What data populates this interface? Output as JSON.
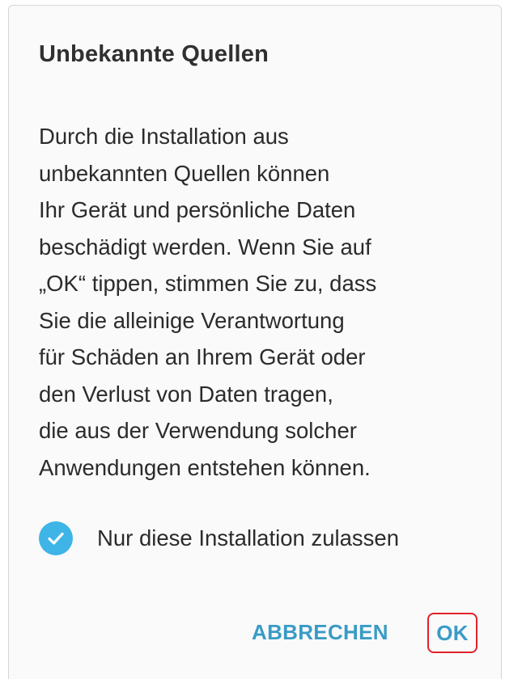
{
  "dialog": {
    "title": "Unbekannte Quellen",
    "message_lines": [
      "Durch die Installation aus",
      "unbekannten Quellen können",
      "Ihr Gerät und persönliche Daten",
      "beschädigt werden. Wenn Sie auf",
      "„OK“ tippen, stimmen Sie zu, dass",
      "Sie die alleinige Verantwortung",
      "für Schäden an Ihrem Gerät oder",
      "den Verlust von Daten tragen,",
      "die aus der Verwendung solcher",
      "Anwendungen entstehen können."
    ],
    "checkbox": {
      "label": "Nur diese Installation zulassen",
      "checked": true,
      "icon": "check-circle-icon"
    },
    "buttons": {
      "cancel_label": "ABBRECHEN",
      "ok_label": "OK"
    }
  },
  "colors": {
    "accent": "#3a9bc6",
    "check": "#3fb4e6",
    "highlight": "#e0222a"
  }
}
